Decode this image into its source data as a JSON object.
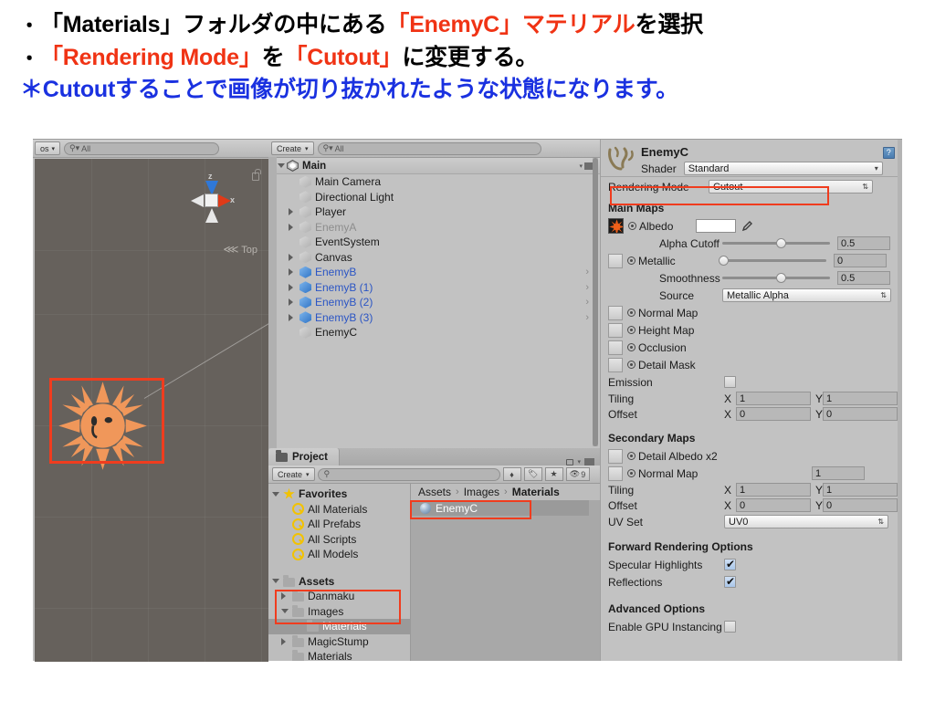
{
  "instructions": {
    "line1": {
      "bullet": "・",
      "seg1": "「Materials」フォルダの中にある",
      "seg2_red": "「EnemyC」マテリアル",
      "seg3": "を選択"
    },
    "line2": {
      "bullet": "・",
      "seg1_red": "「Rendering Mode」",
      "seg2": "を",
      "seg3_red": "「Cutout」",
      "seg4": "に変更する。"
    },
    "line3": {
      "text_blue": "＊Cutoutすることで画像が切り抜かれたような状態になります。"
    }
  },
  "colors": {
    "accent_red": "#f03314",
    "accent_blue": "#1a31e0",
    "highlight_box": "#f03c1e",
    "scene_bg": "#66615c",
    "panel_bg": "#c2c2c2"
  },
  "scene_view": {
    "toolbar": {
      "mode_button": "os",
      "search_placeholder": "All"
    },
    "gizmo": {
      "z_label": "z",
      "x_label": "x"
    },
    "view_label": "Top",
    "lock_icon": "lock-icon"
  },
  "hierarchy": {
    "toolbar": {
      "create_label": "Create",
      "search_placeholder": "All"
    },
    "scene_name": "Main",
    "items": [
      {
        "label": "Main Camera",
        "indent": 1,
        "expandable": false,
        "icon": "cube-grey",
        "style": "normal",
        "chevron": false
      },
      {
        "label": "Directional Light",
        "indent": 1,
        "expandable": false,
        "icon": "cube-grey",
        "style": "normal",
        "chevron": false
      },
      {
        "label": "Player",
        "indent": 1,
        "expandable": true,
        "icon": "cube-grey",
        "style": "normal",
        "chevron": false
      },
      {
        "label": "EnemyA",
        "indent": 1,
        "expandable": true,
        "icon": "cube-grey",
        "style": "dim",
        "chevron": false
      },
      {
        "label": "EventSystem",
        "indent": 1,
        "expandable": false,
        "icon": "cube-grey",
        "style": "normal",
        "chevron": false
      },
      {
        "label": "Canvas",
        "indent": 1,
        "expandable": true,
        "icon": "cube-grey",
        "style": "normal",
        "chevron": false
      },
      {
        "label": "EnemyB",
        "indent": 1,
        "expandable": true,
        "icon": "cube-blue",
        "style": "prefab",
        "chevron": true
      },
      {
        "label": "EnemyB (1)",
        "indent": 1,
        "expandable": true,
        "icon": "cube-blue",
        "style": "prefab",
        "chevron": true
      },
      {
        "label": "EnemyB (2)",
        "indent": 1,
        "expandable": true,
        "icon": "cube-blue",
        "style": "prefab",
        "chevron": true
      },
      {
        "label": "EnemyB (3)",
        "indent": 1,
        "expandable": true,
        "icon": "cube-blue",
        "style": "prefab",
        "chevron": true
      },
      {
        "label": "EnemyC",
        "indent": 1,
        "expandable": false,
        "icon": "cube-grey",
        "style": "normal",
        "chevron": false
      }
    ]
  },
  "project": {
    "tab_label": "Project",
    "toolbar": {
      "create_label": "Create",
      "search_placeholder": "",
      "hidden_count": "9"
    },
    "tree": [
      {
        "label": "Favorites",
        "indent": 0,
        "icon": "star-icon",
        "expandable": true,
        "expanded": true,
        "selected": false
      },
      {
        "label": "All Materials",
        "indent": 1,
        "icon": "search-icon",
        "expandable": false,
        "expanded": false,
        "selected": false
      },
      {
        "label": "All Prefabs",
        "indent": 1,
        "icon": "search-icon",
        "expandable": false,
        "expanded": false,
        "selected": false
      },
      {
        "label": "All Scripts",
        "indent": 1,
        "icon": "search-icon",
        "expandable": false,
        "expanded": false,
        "selected": false
      },
      {
        "label": "All Models",
        "indent": 1,
        "icon": "search-icon",
        "expandable": false,
        "expanded": false,
        "selected": false
      },
      {
        "label": "",
        "indent": 0,
        "icon": "spacer",
        "expandable": false,
        "expanded": false,
        "selected": false
      },
      {
        "label": "Assets",
        "indent": 0,
        "icon": "folder-icon",
        "expandable": true,
        "expanded": true,
        "selected": false
      },
      {
        "label": "Danmaku",
        "indent": 1,
        "icon": "folder-icon",
        "expandable": true,
        "expanded": false,
        "selected": false
      },
      {
        "label": "Images",
        "indent": 1,
        "icon": "folder-icon",
        "expandable": true,
        "expanded": true,
        "selected": false
      },
      {
        "label": "Materials",
        "indent": 2,
        "icon": "folder-icon",
        "expandable": false,
        "expanded": false,
        "selected": true
      },
      {
        "label": "MagicStump",
        "indent": 1,
        "icon": "folder-icon",
        "expandable": true,
        "expanded": false,
        "selected": false
      },
      {
        "label": "Materials",
        "indent": 1,
        "icon": "folder-icon",
        "expandable": false,
        "expanded": false,
        "selected": false
      }
    ],
    "breadcrumb": [
      "Assets",
      "Images",
      "Materials"
    ],
    "assets": [
      {
        "label": "EnemyC",
        "icon": "material-sphere-icon",
        "selected": true
      }
    ]
  },
  "inspector": {
    "material_name": "EnemyC",
    "shader_label": "Shader",
    "shader_value": "Standard",
    "rendering_mode_label": "Rendering Mode",
    "rendering_mode_value": "Cutout",
    "sections": {
      "main_maps": "Main Maps",
      "secondary_maps": "Secondary Maps",
      "forward_rendering": "Forward Rendering Options",
      "advanced": "Advanced Options"
    },
    "main_maps": {
      "albedo_label": "Albedo",
      "alpha_cutoff_label": "Alpha Cutoff",
      "alpha_cutoff_value": "0.5",
      "metallic_label": "Metallic",
      "metallic_value": "0",
      "smoothness_label": "Smoothness",
      "smoothness_value": "0.5",
      "source_label": "Source",
      "source_value": "Metallic Alpha",
      "normal_map_label": "Normal Map",
      "height_map_label": "Height Map",
      "occlusion_label": "Occlusion",
      "detail_mask_label": "Detail Mask",
      "emission_label": "Emission",
      "tiling_label": "Tiling",
      "tiling_x": "1",
      "tiling_y": "1",
      "offset_label": "Offset",
      "offset_x": "0",
      "offset_y": "0",
      "x_label": "X",
      "y_label": "Y"
    },
    "secondary_maps": {
      "detail_albedo_label": "Detail Albedo x2",
      "normal_map_label": "Normal Map",
      "normal_map_value": "1",
      "tiling_label": "Tiling",
      "tiling_x": "1",
      "tiling_y": "1",
      "offset_label": "Offset",
      "offset_x": "0",
      "offset_y": "0",
      "uv_set_label": "UV Set",
      "uv_set_value": "UV0",
      "x_label": "X",
      "y_label": "Y"
    },
    "forward_rendering": {
      "specular_label": "Specular Highlights",
      "reflections_label": "Reflections"
    },
    "advanced": {
      "gpu_instancing_label": "Enable GPU Instancing"
    }
  }
}
